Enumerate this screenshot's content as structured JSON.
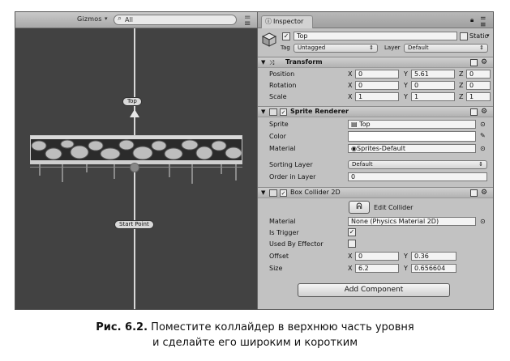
{
  "scene": {
    "gizmos_label": "Gizmos",
    "gizmos_caret": "▾",
    "search_placeholder": "All",
    "search_icon": "search-icon",
    "label_top": "Top",
    "label_start": "Start Point"
  },
  "inspector": {
    "tab_title": "Inspector",
    "tab_icon": "info-icon",
    "object_name": "Top",
    "static_label": "Static",
    "tag_label": "Tag",
    "tag_value": "Untagged",
    "layer_label": "Layer",
    "layer_value": "Default",
    "transform": {
      "title": "Transform",
      "position_label": "Position",
      "rotation_label": "Rotation",
      "scale_label": "Scale",
      "position": {
        "x": "0",
        "y": "5.61",
        "z": "0"
      },
      "rotation": {
        "x": "0",
        "y": "0",
        "z": "0"
      },
      "scale": {
        "x": "1",
        "y": "1",
        "z": "1"
      }
    },
    "sprite_renderer": {
      "title": "Sprite Renderer",
      "sprite_label": "Sprite",
      "sprite_value": "Top",
      "color_label": "Color",
      "material_label": "Material",
      "material_value": "Sprites-Default",
      "sorting_layer_label": "Sorting Layer",
      "sorting_layer_value": "Default",
      "order_label": "Order in Layer",
      "order_value": "0"
    },
    "box_collider": {
      "title": "Box Collider 2D",
      "edit_collider_label": "Edit Collider",
      "material_label": "Material",
      "material_value": "None (Physics Material 2D)",
      "is_trigger_label": "Is Trigger",
      "is_trigger": true,
      "used_by_effector_label": "Used By Effector",
      "used_by_effector": false,
      "offset_label": "Offset",
      "offset": {
        "x": "0",
        "y": "0.36"
      },
      "size_label": "Size",
      "size": {
        "x": "6.2",
        "y": "0.656604"
      }
    },
    "add_component_label": "Add Component"
  },
  "axis_labels": {
    "x": "X",
    "y": "Y",
    "z": "Z"
  },
  "caption": {
    "bold": "Рис. 6.2.",
    "line1": "Поместите коллайдер в верхнюю часть уровня",
    "line2": "и сделайте его широким и коротким"
  }
}
